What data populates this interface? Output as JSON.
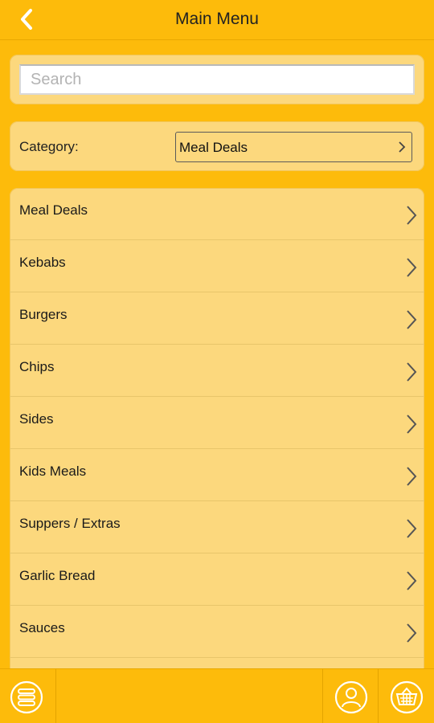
{
  "header": {
    "title": "Main Menu",
    "back_icon": "chevron-left-icon"
  },
  "search": {
    "placeholder": "Search",
    "value": ""
  },
  "category": {
    "label": "Category:",
    "selected": "Meal Deals"
  },
  "menu_items": [
    {
      "label": "Meal Deals"
    },
    {
      "label": "Kebabs"
    },
    {
      "label": "Burgers"
    },
    {
      "label": "Chips"
    },
    {
      "label": "Sides"
    },
    {
      "label": "Kids Meals"
    },
    {
      "label": "Suppers / Extras"
    },
    {
      "label": "Garlic Bread"
    },
    {
      "label": "Sauces"
    },
    {
      "label": ""
    }
  ],
  "footer": {
    "icons": [
      "menu-stack-icon",
      "user-icon",
      "basket-icon"
    ]
  },
  "colors": {
    "background": "#FDBB0B",
    "panel": "#FCD87D",
    "text": "#1a1a1a"
  }
}
